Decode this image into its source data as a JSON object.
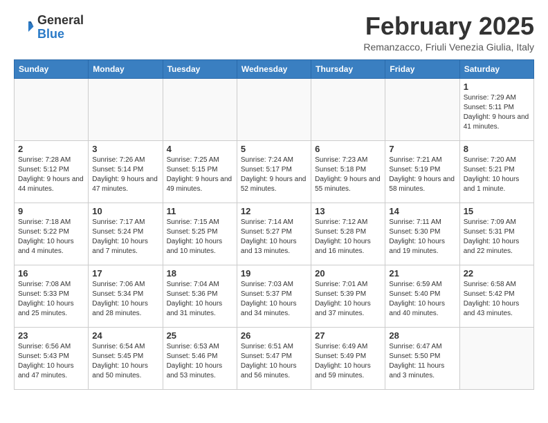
{
  "header": {
    "logo_general": "General",
    "logo_blue": "Blue",
    "month_title": "February 2025",
    "subtitle": "Remanzacco, Friuli Venezia Giulia, Italy"
  },
  "weekdays": [
    "Sunday",
    "Monday",
    "Tuesday",
    "Wednesday",
    "Thursday",
    "Friday",
    "Saturday"
  ],
  "weeks": [
    [
      {
        "day": "",
        "info": ""
      },
      {
        "day": "",
        "info": ""
      },
      {
        "day": "",
        "info": ""
      },
      {
        "day": "",
        "info": ""
      },
      {
        "day": "",
        "info": ""
      },
      {
        "day": "",
        "info": ""
      },
      {
        "day": "1",
        "info": "Sunrise: 7:29 AM\nSunset: 5:11 PM\nDaylight: 9 hours and 41 minutes."
      }
    ],
    [
      {
        "day": "2",
        "info": "Sunrise: 7:28 AM\nSunset: 5:12 PM\nDaylight: 9 hours and 44 minutes."
      },
      {
        "day": "3",
        "info": "Sunrise: 7:26 AM\nSunset: 5:14 PM\nDaylight: 9 hours and 47 minutes."
      },
      {
        "day": "4",
        "info": "Sunrise: 7:25 AM\nSunset: 5:15 PM\nDaylight: 9 hours and 49 minutes."
      },
      {
        "day": "5",
        "info": "Sunrise: 7:24 AM\nSunset: 5:17 PM\nDaylight: 9 hours and 52 minutes."
      },
      {
        "day": "6",
        "info": "Sunrise: 7:23 AM\nSunset: 5:18 PM\nDaylight: 9 hours and 55 minutes."
      },
      {
        "day": "7",
        "info": "Sunrise: 7:21 AM\nSunset: 5:19 PM\nDaylight: 9 hours and 58 minutes."
      },
      {
        "day": "8",
        "info": "Sunrise: 7:20 AM\nSunset: 5:21 PM\nDaylight: 10 hours and 1 minute."
      }
    ],
    [
      {
        "day": "9",
        "info": "Sunrise: 7:18 AM\nSunset: 5:22 PM\nDaylight: 10 hours and 4 minutes."
      },
      {
        "day": "10",
        "info": "Sunrise: 7:17 AM\nSunset: 5:24 PM\nDaylight: 10 hours and 7 minutes."
      },
      {
        "day": "11",
        "info": "Sunrise: 7:15 AM\nSunset: 5:25 PM\nDaylight: 10 hours and 10 minutes."
      },
      {
        "day": "12",
        "info": "Sunrise: 7:14 AM\nSunset: 5:27 PM\nDaylight: 10 hours and 13 minutes."
      },
      {
        "day": "13",
        "info": "Sunrise: 7:12 AM\nSunset: 5:28 PM\nDaylight: 10 hours and 16 minutes."
      },
      {
        "day": "14",
        "info": "Sunrise: 7:11 AM\nSunset: 5:30 PM\nDaylight: 10 hours and 19 minutes."
      },
      {
        "day": "15",
        "info": "Sunrise: 7:09 AM\nSunset: 5:31 PM\nDaylight: 10 hours and 22 minutes."
      }
    ],
    [
      {
        "day": "16",
        "info": "Sunrise: 7:08 AM\nSunset: 5:33 PM\nDaylight: 10 hours and 25 minutes."
      },
      {
        "day": "17",
        "info": "Sunrise: 7:06 AM\nSunset: 5:34 PM\nDaylight: 10 hours and 28 minutes."
      },
      {
        "day": "18",
        "info": "Sunrise: 7:04 AM\nSunset: 5:36 PM\nDaylight: 10 hours and 31 minutes."
      },
      {
        "day": "19",
        "info": "Sunrise: 7:03 AM\nSunset: 5:37 PM\nDaylight: 10 hours and 34 minutes."
      },
      {
        "day": "20",
        "info": "Sunrise: 7:01 AM\nSunset: 5:39 PM\nDaylight: 10 hours and 37 minutes."
      },
      {
        "day": "21",
        "info": "Sunrise: 6:59 AM\nSunset: 5:40 PM\nDaylight: 10 hours and 40 minutes."
      },
      {
        "day": "22",
        "info": "Sunrise: 6:58 AM\nSunset: 5:42 PM\nDaylight: 10 hours and 43 minutes."
      }
    ],
    [
      {
        "day": "23",
        "info": "Sunrise: 6:56 AM\nSunset: 5:43 PM\nDaylight: 10 hours and 47 minutes."
      },
      {
        "day": "24",
        "info": "Sunrise: 6:54 AM\nSunset: 5:45 PM\nDaylight: 10 hours and 50 minutes."
      },
      {
        "day": "25",
        "info": "Sunrise: 6:53 AM\nSunset: 5:46 PM\nDaylight: 10 hours and 53 minutes."
      },
      {
        "day": "26",
        "info": "Sunrise: 6:51 AM\nSunset: 5:47 PM\nDaylight: 10 hours and 56 minutes."
      },
      {
        "day": "27",
        "info": "Sunrise: 6:49 AM\nSunset: 5:49 PM\nDaylight: 10 hours and 59 minutes."
      },
      {
        "day": "28",
        "info": "Sunrise: 6:47 AM\nSunset: 5:50 PM\nDaylight: 11 hours and 3 minutes."
      },
      {
        "day": "",
        "info": ""
      }
    ]
  ]
}
